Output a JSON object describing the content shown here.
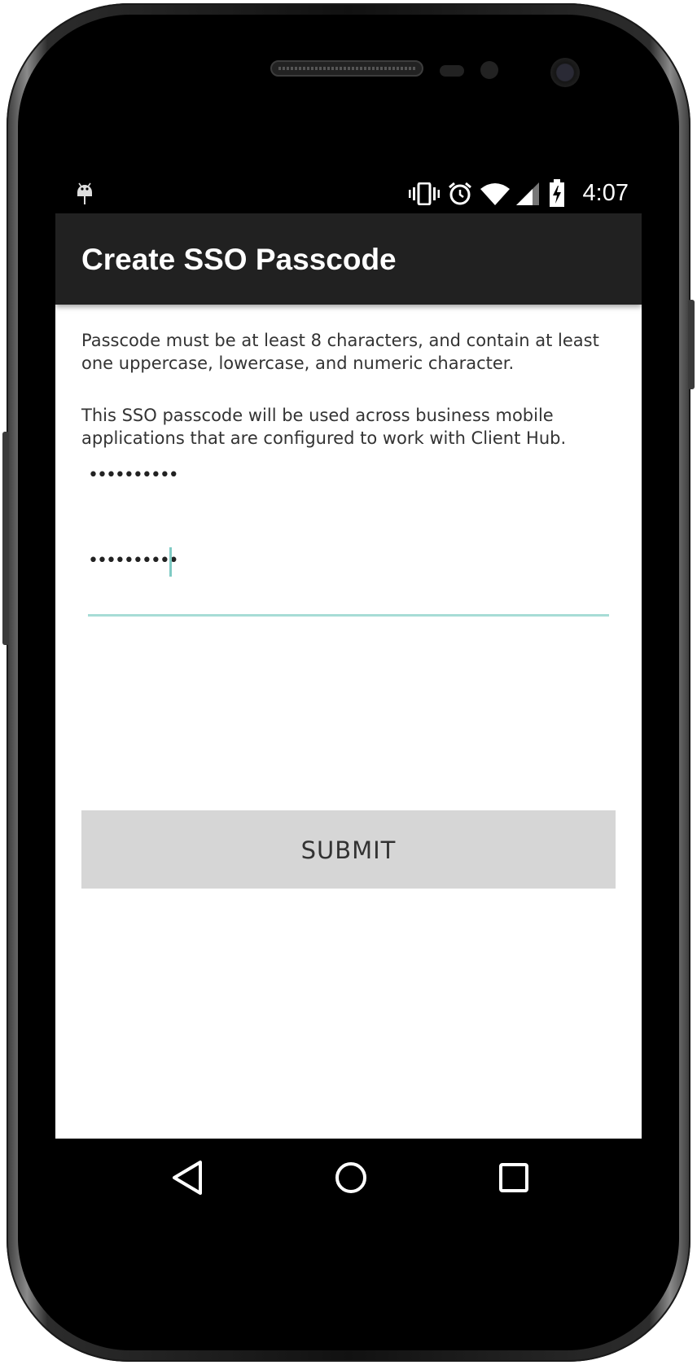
{
  "status_bar": {
    "time": "4:07",
    "icons": [
      "android-debug-icon",
      "vibrate-icon",
      "alarm-icon",
      "wifi-icon",
      "signal-icon",
      "battery-charging-icon"
    ]
  },
  "app_bar": {
    "title": "Create SSO Passcode"
  },
  "content": {
    "requirements_text": "Passcode must be at least 8 characters, and contain at least one uppercase, lowercase, and numeric character.",
    "info_text": "This SSO passcode will be used across business mobile applications that are configured to work with Client Hub.",
    "passcode_field": {
      "value": "••••••••••"
    },
    "confirm_field": {
      "value": "••••••••••"
    },
    "submit_label": "SUBMIT"
  },
  "nav_bar": {
    "buttons": [
      "back-icon",
      "home-icon",
      "recents-icon"
    ]
  },
  "colors": {
    "app_bar": "#212121",
    "accent": "#80cbc4",
    "button": "#d6d6d6"
  }
}
